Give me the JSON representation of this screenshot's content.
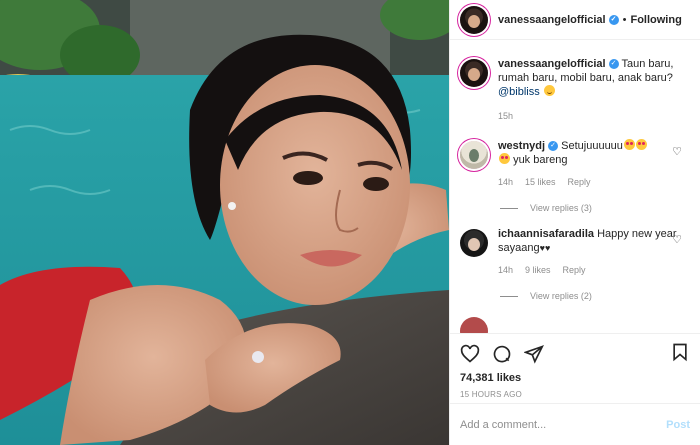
{
  "header": {
    "username": "vanessaangelofficial",
    "separator": "•",
    "follow_label": "Following"
  },
  "caption": {
    "username": "vanessaangelofficial",
    "text": "Taun baru, rumah baru, mobil baru, anak baru?",
    "mention": "@bibliss",
    "time": "15h"
  },
  "comments": [
    {
      "username": "westnydj",
      "text": "Setujuuuuuu",
      "text2": "yuk bareng",
      "time": "14h",
      "likes": "15 likes",
      "reply_label": "Reply",
      "view_replies": "View replies (3)"
    },
    {
      "username": "ichaannisafaradila",
      "text": "Happy new year sayaang",
      "hearts": "♥♥",
      "time": "14h",
      "likes": "9 likes",
      "reply_label": "Reply",
      "view_replies": "View replies (2)"
    }
  ],
  "actions": {
    "likes": "74,381 likes",
    "posted_ago": "15 HOURS AGO",
    "like_icon": "heart-icon",
    "comment_icon": "comment-icon",
    "share_icon": "share-icon",
    "save_icon": "bookmark-icon"
  },
  "comment_box": {
    "placeholder": "Add a comment...",
    "post_label": "Post"
  },
  "colors": {
    "verified": "#3897f0",
    "link": "#00376b",
    "muted": "#8e8e8e",
    "post_disabled": "#b2dffc"
  }
}
